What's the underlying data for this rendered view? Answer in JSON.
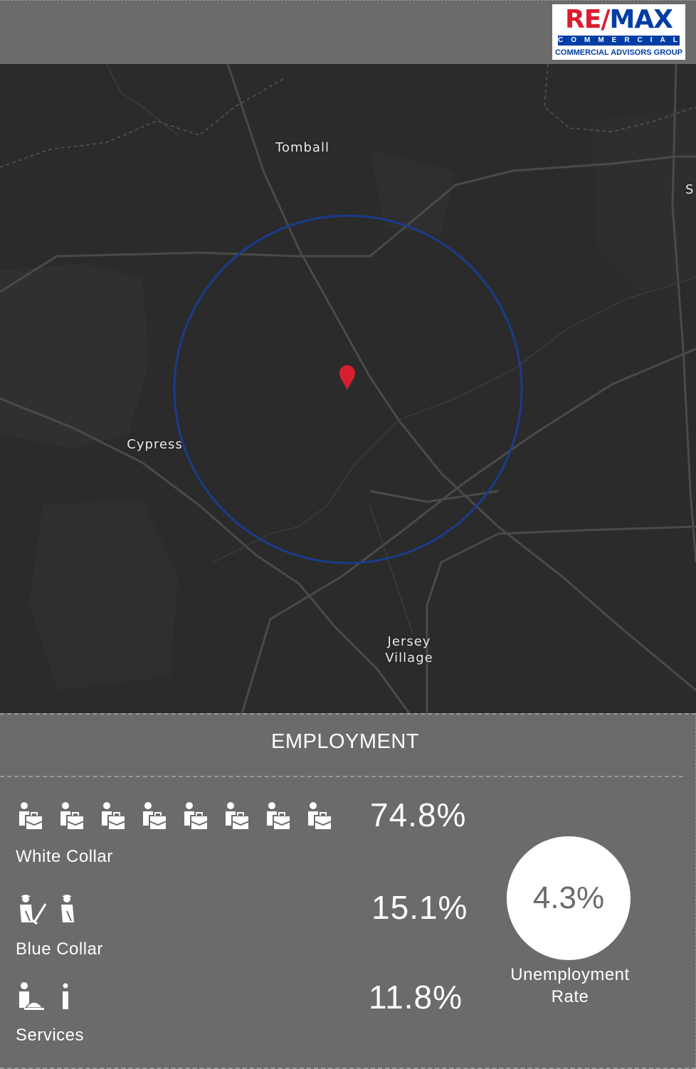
{
  "brand": {
    "logo_line1_red": "RE/",
    "logo_line1_blue": "MAX",
    "logo_line2": "COMMERCIAL",
    "logo_line3": "COMMERCIAL ADVISORS GROUP",
    "colors": {
      "red": "#dc1c2e",
      "blue": "#003da5"
    }
  },
  "map": {
    "labels": {
      "tomball": "Tomball",
      "cypress": "Cypress",
      "jersey_village_1": "Jersey",
      "jersey_village_2": "Village",
      "edge_s": "S"
    },
    "marker_icon": "location-pin-icon",
    "colors": {
      "radius_circle": "#1a3c8c",
      "marker": "#d42030",
      "background": "#2b2b2b",
      "roads": "#4a4a4a"
    }
  },
  "employment": {
    "title": "EMPLOYMENT",
    "white_collar": {
      "label": "White Collar",
      "percent": "74.8%",
      "icon": "office-worker-icon",
      "icon_count": 8
    },
    "blue_collar": {
      "label": "Blue Collar",
      "percent": "15.1%",
      "icon": "laborer-icon",
      "icon_count": 2
    },
    "services": {
      "label": "Services",
      "percent": "11.8%",
      "icon": "service-worker-icon",
      "icon_count": 2
    },
    "unemployment": {
      "value": "4.3%",
      "label_line1": "Unemployment",
      "label_line2": "Rate"
    }
  }
}
